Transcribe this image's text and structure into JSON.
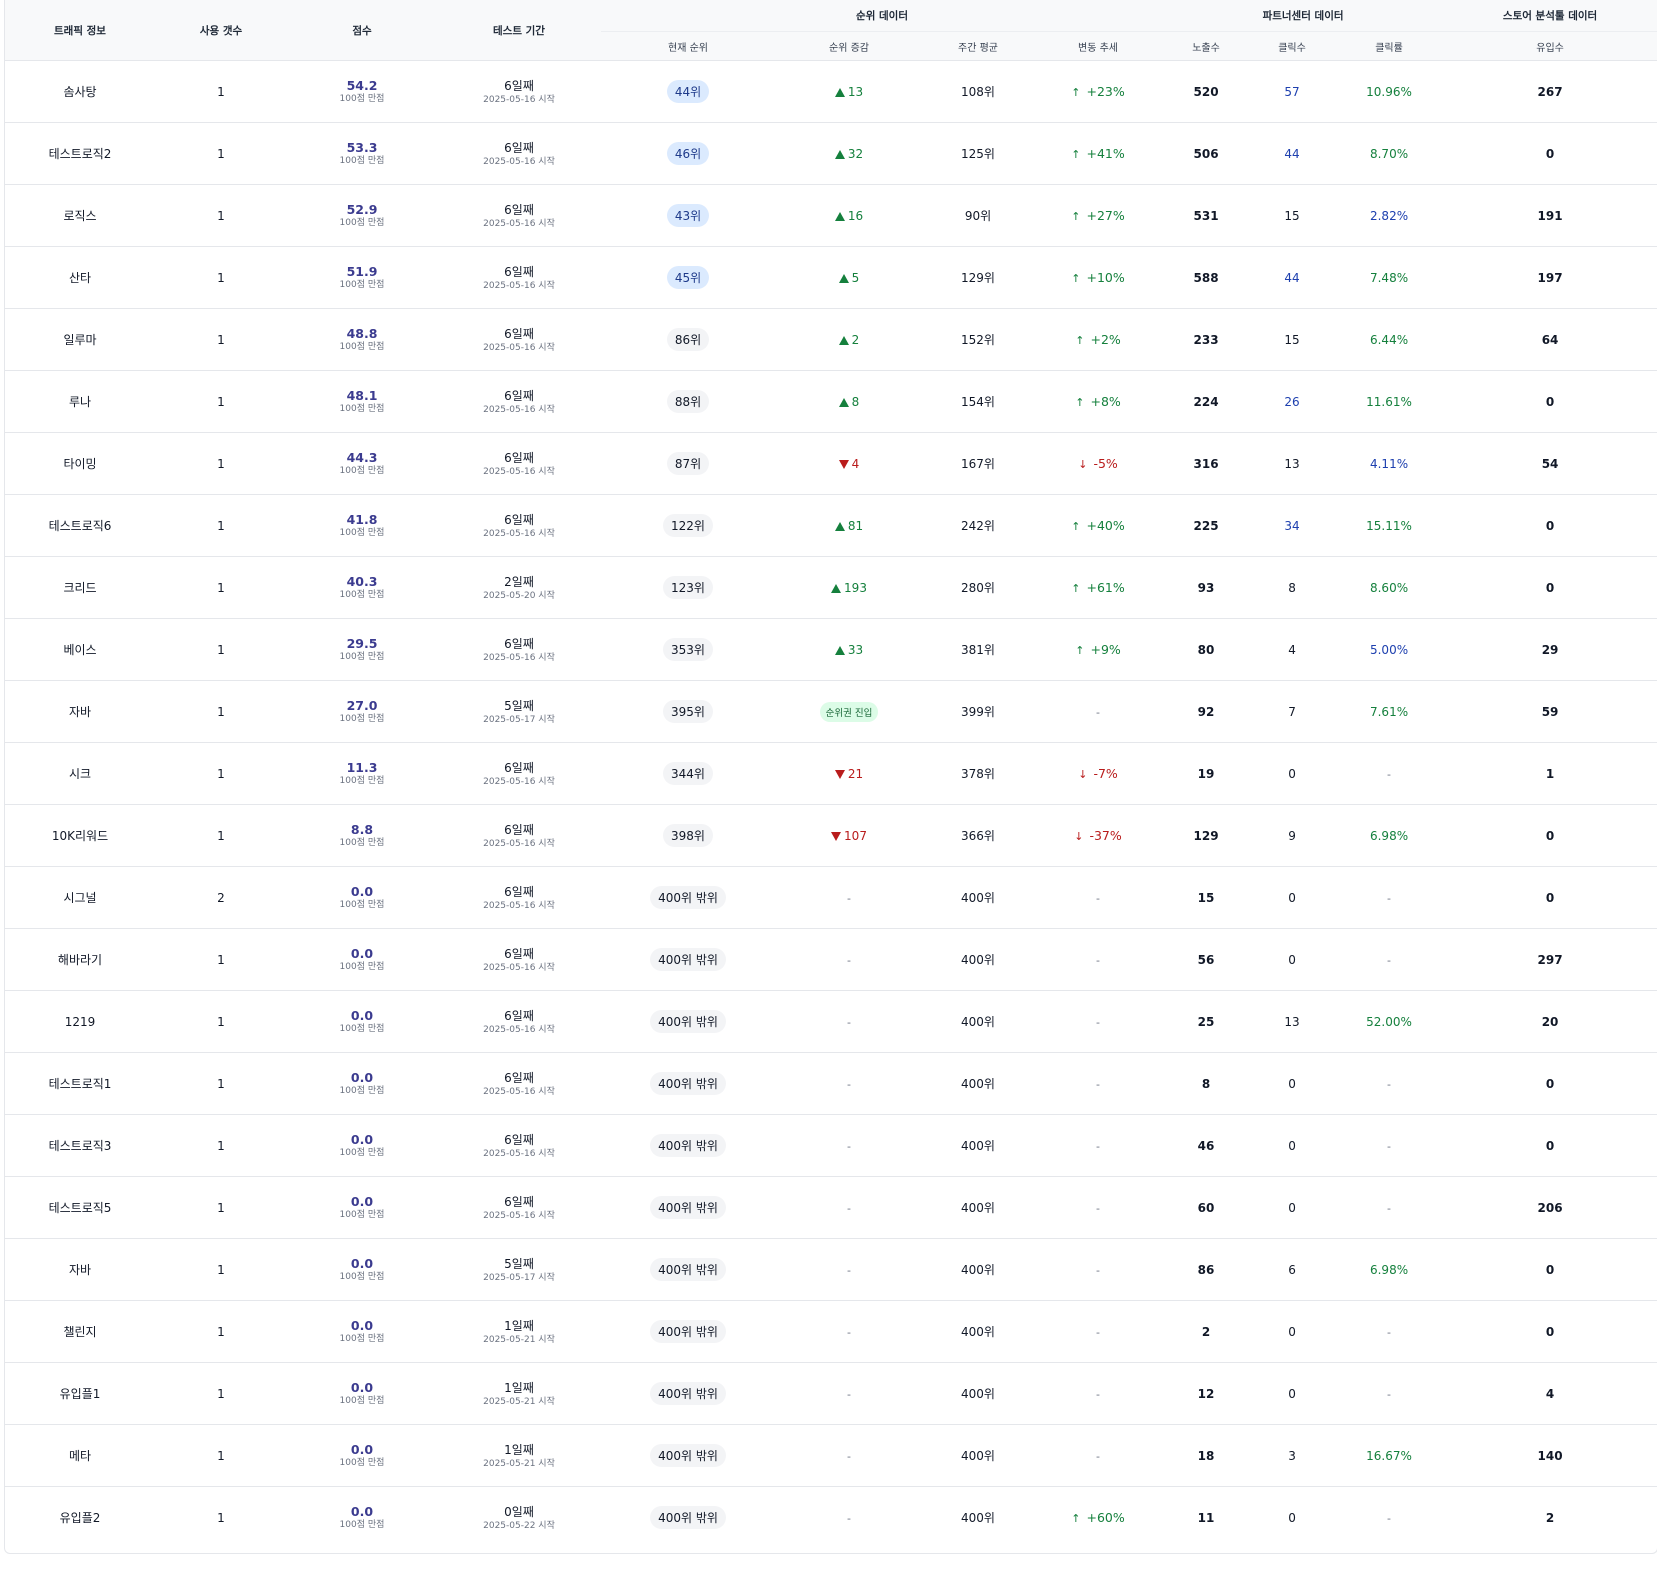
{
  "headers": {
    "traffic_info": "트래픽 정보",
    "usage_count": "사용 갯수",
    "score": "점수",
    "test_period": "테스트 기간",
    "rank_data": "순위 데이터",
    "partner_data": "파트너센터 데이터",
    "store_data": "스토어 분석툴 데이터",
    "current_rank": "현재 순위",
    "rank_change": "순위 증감",
    "weekly_avg": "주간 평균",
    "trend": "변동 추세",
    "impressions": "노출수",
    "clicks": "클릭수",
    "ctr": "클릭률",
    "inflow": "유입수"
  },
  "colors": {
    "up": "#15803d",
    "down": "#b91c1c",
    "score": "#3b3b8f",
    "blue": "#1e40af",
    "top_rank_bg": "#dbeafe"
  },
  "rows": [
    {
      "name": "솜사탕",
      "count": "1",
      "score": "54.2",
      "score_sub": "100점 만점",
      "period": "6일째",
      "start": "2025-05-16 시작",
      "rank": "44위",
      "rank_top": true,
      "change_dir": "up",
      "change": "13",
      "weekly": "108위",
      "trend_dir": "up",
      "trend_arrow": "↑",
      "trend": "+23%",
      "impressions": "520",
      "clicks": "57",
      "clicks_color": "blue",
      "ctr": "10.96%",
      "ctr_color": "green",
      "inflow": "267"
    },
    {
      "name": "테스트로직2",
      "count": "1",
      "score": "53.3",
      "score_sub": "100점 만점",
      "period": "6일째",
      "start": "2025-05-16 시작",
      "rank": "46위",
      "rank_top": true,
      "change_dir": "up",
      "change": "32",
      "weekly": "125위",
      "trend_dir": "up",
      "trend_arrow": "↑",
      "trend": "+41%",
      "impressions": "506",
      "clicks": "44",
      "clicks_color": "blue",
      "ctr": "8.70%",
      "ctr_color": "green",
      "inflow": "0"
    },
    {
      "name": "로직스",
      "count": "1",
      "score": "52.9",
      "score_sub": "100점 만점",
      "period": "6일째",
      "start": "2025-05-16 시작",
      "rank": "43위",
      "rank_top": true,
      "change_dir": "up",
      "change": "16",
      "weekly": "90위",
      "trend_dir": "up",
      "trend_arrow": "↑",
      "trend": "+27%",
      "impressions": "531",
      "clicks": "15",
      "clicks_color": "plain",
      "ctr": "2.82%",
      "ctr_color": "blue",
      "inflow": "191"
    },
    {
      "name": "산타",
      "count": "1",
      "score": "51.9",
      "score_sub": "100점 만점",
      "period": "6일째",
      "start": "2025-05-16 시작",
      "rank": "45위",
      "rank_top": true,
      "change_dir": "up",
      "change": "5",
      "weekly": "129위",
      "trend_dir": "up",
      "trend_arrow": "↑",
      "trend": "+10%",
      "impressions": "588",
      "clicks": "44",
      "clicks_color": "blue",
      "ctr": "7.48%",
      "ctr_color": "green",
      "inflow": "197"
    },
    {
      "name": "일루마",
      "count": "1",
      "score": "48.8",
      "score_sub": "100점 만점",
      "period": "6일째",
      "start": "2025-05-16 시작",
      "rank": "86위",
      "rank_top": false,
      "change_dir": "up",
      "change": "2",
      "weekly": "152위",
      "trend_dir": "up",
      "trend_arrow": "↑",
      "trend": "+2%",
      "impressions": "233",
      "clicks": "15",
      "clicks_color": "plain",
      "ctr": "6.44%",
      "ctr_color": "green",
      "inflow": "64"
    },
    {
      "name": "루나",
      "count": "1",
      "score": "48.1",
      "score_sub": "100점 만점",
      "period": "6일째",
      "start": "2025-05-16 시작",
      "rank": "88위",
      "rank_top": false,
      "change_dir": "up",
      "change": "8",
      "weekly": "154위",
      "trend_dir": "up",
      "trend_arrow": "↑",
      "trend": "+8%",
      "impressions": "224",
      "clicks": "26",
      "clicks_color": "blue",
      "ctr": "11.61%",
      "ctr_color": "green",
      "inflow": "0"
    },
    {
      "name": "타이밍",
      "count": "1",
      "score": "44.3",
      "score_sub": "100점 만점",
      "period": "6일째",
      "start": "2025-05-16 시작",
      "rank": "87위",
      "rank_top": false,
      "change_dir": "down",
      "change": "4",
      "weekly": "167위",
      "trend_dir": "down",
      "trend_arrow": "↓",
      "trend": "-5%",
      "impressions": "316",
      "clicks": "13",
      "clicks_color": "plain",
      "ctr": "4.11%",
      "ctr_color": "blue",
      "inflow": "54"
    },
    {
      "name": "테스트로직6",
      "count": "1",
      "score": "41.8",
      "score_sub": "100점 만점",
      "period": "6일째",
      "start": "2025-05-16 시작",
      "rank": "122위",
      "rank_top": false,
      "change_dir": "up",
      "change": "81",
      "weekly": "242위",
      "trend_dir": "up",
      "trend_arrow": "↑",
      "trend": "+40%",
      "impressions": "225",
      "clicks": "34",
      "clicks_color": "blue",
      "ctr": "15.11%",
      "ctr_color": "green",
      "inflow": "0"
    },
    {
      "name": "크리드",
      "count": "1",
      "score": "40.3",
      "score_sub": "100점 만점",
      "period": "2일째",
      "start": "2025-05-20 시작",
      "rank": "123위",
      "rank_top": false,
      "change_dir": "up",
      "change": "193",
      "weekly": "280위",
      "trend_dir": "up",
      "trend_arrow": "↑",
      "trend": "+61%",
      "impressions": "93",
      "clicks": "8",
      "clicks_color": "plain",
      "ctr": "8.60%",
      "ctr_color": "green",
      "inflow": "0"
    },
    {
      "name": "베이스",
      "count": "1",
      "score": "29.5",
      "score_sub": "100점 만점",
      "period": "6일째",
      "start": "2025-05-16 시작",
      "rank": "353위",
      "rank_top": false,
      "change_dir": "up",
      "change": "33",
      "weekly": "381위",
      "trend_dir": "up",
      "trend_arrow": "↑",
      "trend": "+9%",
      "impressions": "80",
      "clicks": "4",
      "clicks_color": "plain",
      "ctr": "5.00%",
      "ctr_color": "blue",
      "inflow": "29"
    },
    {
      "name": "자바",
      "count": "1",
      "score": "27.0",
      "score_sub": "100점 만점",
      "period": "5일째",
      "start": "2025-05-17 시작",
      "rank": "395위",
      "rank_top": false,
      "change_dir": "entry",
      "change": "순위권 진입",
      "weekly": "399위",
      "trend_dir": "none",
      "trend_arrow": "",
      "trend": "-",
      "impressions": "92",
      "clicks": "7",
      "clicks_color": "plain",
      "ctr": "7.61%",
      "ctr_color": "green",
      "inflow": "59"
    },
    {
      "name": "시크",
      "count": "1",
      "score": "11.3",
      "score_sub": "100점 만점",
      "period": "6일째",
      "start": "2025-05-16 시작",
      "rank": "344위",
      "rank_top": false,
      "change_dir": "down",
      "change": "21",
      "weekly": "378위",
      "trend_dir": "down",
      "trend_arrow": "↓",
      "trend": "-7%",
      "impressions": "19",
      "clicks": "0",
      "clicks_color": "plain",
      "ctr": "-",
      "ctr_color": "dash",
      "inflow": "1"
    },
    {
      "name": "10K리워드",
      "count": "1",
      "score": "8.8",
      "score_sub": "100점 만점",
      "period": "6일째",
      "start": "2025-05-16 시작",
      "rank": "398위",
      "rank_top": false,
      "change_dir": "down",
      "change": "107",
      "weekly": "366위",
      "trend_dir": "down",
      "trend_arrow": "↓",
      "trend": "-37%",
      "impressions": "129",
      "clicks": "9",
      "clicks_color": "plain",
      "ctr": "6.98%",
      "ctr_color": "green",
      "inflow": "0"
    },
    {
      "name": "시그널",
      "count": "2",
      "score": "0.0",
      "score_sub": "100점 만점",
      "period": "6일째",
      "start": "2025-05-16 시작",
      "rank": "400위 밖위",
      "rank_top": false,
      "change_dir": "none",
      "change": "-",
      "weekly": "400위",
      "trend_dir": "none",
      "trend_arrow": "",
      "trend": "-",
      "impressions": "15",
      "clicks": "0",
      "clicks_color": "plain",
      "ctr": "-",
      "ctr_color": "dash",
      "inflow": "0"
    },
    {
      "name": "해바라기",
      "count": "1",
      "score": "0.0",
      "score_sub": "100점 만점",
      "period": "6일째",
      "start": "2025-05-16 시작",
      "rank": "400위 밖위",
      "rank_top": false,
      "change_dir": "none",
      "change": "-",
      "weekly": "400위",
      "trend_dir": "none",
      "trend_arrow": "",
      "trend": "-",
      "impressions": "56",
      "clicks": "0",
      "clicks_color": "plain",
      "ctr": "-",
      "ctr_color": "dash",
      "inflow": "297"
    },
    {
      "name": "1219",
      "count": "1",
      "score": "0.0",
      "score_sub": "100점 만점",
      "period": "6일째",
      "start": "2025-05-16 시작",
      "rank": "400위 밖위",
      "rank_top": false,
      "change_dir": "none",
      "change": "-",
      "weekly": "400위",
      "trend_dir": "none",
      "trend_arrow": "",
      "trend": "-",
      "impressions": "25",
      "clicks": "13",
      "clicks_color": "plain",
      "ctr": "52.00%",
      "ctr_color": "green",
      "inflow": "20"
    },
    {
      "name": "테스트로직1",
      "count": "1",
      "score": "0.0",
      "score_sub": "100점 만점",
      "period": "6일째",
      "start": "2025-05-16 시작",
      "rank": "400위 밖위",
      "rank_top": false,
      "change_dir": "none",
      "change": "-",
      "weekly": "400위",
      "trend_dir": "none",
      "trend_arrow": "",
      "trend": "-",
      "impressions": "8",
      "clicks": "0",
      "clicks_color": "plain",
      "ctr": "-",
      "ctr_color": "dash",
      "inflow": "0"
    },
    {
      "name": "테스트로직3",
      "count": "1",
      "score": "0.0",
      "score_sub": "100점 만점",
      "period": "6일째",
      "start": "2025-05-16 시작",
      "rank": "400위 밖위",
      "rank_top": false,
      "change_dir": "none",
      "change": "-",
      "weekly": "400위",
      "trend_dir": "none",
      "trend_arrow": "",
      "trend": "-",
      "impressions": "46",
      "clicks": "0",
      "clicks_color": "plain",
      "ctr": "-",
      "ctr_color": "dash",
      "inflow": "0"
    },
    {
      "name": "테스트로직5",
      "count": "1",
      "score": "0.0",
      "score_sub": "100점 만점",
      "period": "6일째",
      "start": "2025-05-16 시작",
      "rank": "400위 밖위",
      "rank_top": false,
      "change_dir": "none",
      "change": "-",
      "weekly": "400위",
      "trend_dir": "none",
      "trend_arrow": "",
      "trend": "-",
      "impressions": "60",
      "clicks": "0",
      "clicks_color": "plain",
      "ctr": "-",
      "ctr_color": "dash",
      "inflow": "206"
    },
    {
      "name": "자바",
      "count": "1",
      "score": "0.0",
      "score_sub": "100점 만점",
      "period": "5일째",
      "start": "2025-05-17 시작",
      "rank": "400위 밖위",
      "rank_top": false,
      "change_dir": "none",
      "change": "-",
      "weekly": "400위",
      "trend_dir": "none",
      "trend_arrow": "",
      "trend": "-",
      "impressions": "86",
      "clicks": "6",
      "clicks_color": "plain",
      "ctr": "6.98%",
      "ctr_color": "green",
      "inflow": "0"
    },
    {
      "name": "챌린지",
      "count": "1",
      "score": "0.0",
      "score_sub": "100점 만점",
      "period": "1일째",
      "start": "2025-05-21 시작",
      "rank": "400위 밖위",
      "rank_top": false,
      "change_dir": "none",
      "change": "-",
      "weekly": "400위",
      "trend_dir": "none",
      "trend_arrow": "",
      "trend": "-",
      "impressions": "2",
      "clicks": "0",
      "clicks_color": "plain",
      "ctr": "-",
      "ctr_color": "dash",
      "inflow": "0"
    },
    {
      "name": "유입플1",
      "count": "1",
      "score": "0.0",
      "score_sub": "100점 만점",
      "period": "1일째",
      "start": "2025-05-21 시작",
      "rank": "400위 밖위",
      "rank_top": false,
      "change_dir": "none",
      "change": "-",
      "weekly": "400위",
      "trend_dir": "none",
      "trend_arrow": "",
      "trend": "-",
      "impressions": "12",
      "clicks": "0",
      "clicks_color": "plain",
      "ctr": "-",
      "ctr_color": "dash",
      "inflow": "4"
    },
    {
      "name": "메타",
      "count": "1",
      "score": "0.0",
      "score_sub": "100점 만점",
      "period": "1일째",
      "start": "2025-05-21 시작",
      "rank": "400위 밖위",
      "rank_top": false,
      "change_dir": "none",
      "change": "-",
      "weekly": "400위",
      "trend_dir": "none",
      "trend_arrow": "",
      "trend": "-",
      "impressions": "18",
      "clicks": "3",
      "clicks_color": "plain",
      "ctr": "16.67%",
      "ctr_color": "green",
      "inflow": "140"
    },
    {
      "name": "유입플2",
      "count": "1",
      "score": "0.0",
      "score_sub": "100점 만점",
      "period": "0일째",
      "start": "2025-05-22 시작",
      "rank": "400위 밖위",
      "rank_top": false,
      "change_dir": "none",
      "change": "-",
      "weekly": "400위",
      "trend_dir": "up",
      "trend_arrow": "↑",
      "trend": "+60%",
      "impressions": "11",
      "clicks": "0",
      "clicks_color": "plain",
      "ctr": "-",
      "ctr_color": "dash",
      "inflow": "2"
    }
  ]
}
